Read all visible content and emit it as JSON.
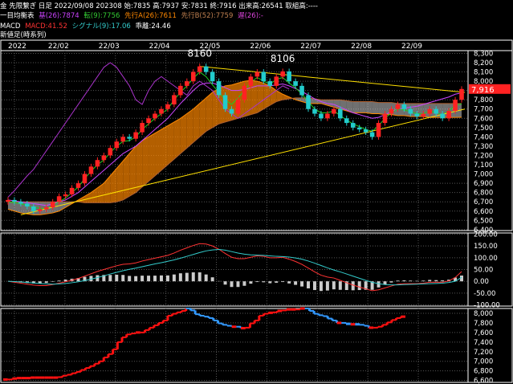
{
  "header": {
    "line1": "金 先限繋ぎ 日足 2022/09/08 202308 始:7835 高:7937 安:7831 終:7916 出来高:26541 取組高:----",
    "ichimoku": {
      "name": "一目均衡表",
      "items": [
        {
          "text": "基(26):7874",
          "color": "#cc44ff"
        },
        {
          "text": "転(9):7756",
          "color": "#33cc33"
        },
        {
          "text": "先行A(26):7611",
          "color": "#ff8800"
        },
        {
          "text": "先行B(52):7759",
          "color": "#c08050"
        },
        {
          "text": "遅(26):-",
          "color": "#dd44dd"
        }
      ]
    },
    "macd": {
      "name": "MACD",
      "items": [
        {
          "text": "MACD:41.52",
          "color": "#ff3333"
        },
        {
          "text": "シグナル(9):17.06",
          "color": "#33cccc"
        },
        {
          "text": "乖離:24.46",
          "color": "#ffffff"
        }
      ]
    },
    "line4": "新値足(時系列)"
  },
  "colors": {
    "up": "#ff2222",
    "down": "#22cccc",
    "tenkan": "#22cc22",
    "kijun": "#cc44ff",
    "chikou": "#aa33cc",
    "kumoUp": "#ff8800",
    "kumoDown": "#cccccc",
    "trend": "#ffe000",
    "macd": "#ff3333",
    "signal": "#33cccc",
    "hist": "#cccccc",
    "pos": "#ff1111",
    "neg": "#3399ff",
    "grid": "#555555",
    "last": "#ff2222"
  },
  "chart_data": [
    {
      "type": "candlestick",
      "x_labels": [
        "2022",
        "22/02",
        "22/03",
        "22/04",
        "22/05",
        "22/06",
        "22/07",
        "22/08",
        "22/09"
      ],
      "y_ticks": [
        6400,
        6500,
        6600,
        6700,
        6800,
        6900,
        7000,
        7100,
        7200,
        7300,
        7400,
        7500,
        7600,
        7700,
        7800,
        7900,
        8000,
        8100,
        8200,
        8300
      ],
      "ylim": [
        6390,
        8330
      ],
      "annotations": [
        {
          "text": "8160",
          "value": 8160
        },
        {
          "text": "8106",
          "value": 8106
        }
      ],
      "last_value": 7916,
      "last_label": "7,916",
      "series": [
        {
          "name": "close",
          "values": [
            6720,
            6700,
            6680,
            6650,
            6600,
            6620,
            6640,
            6700,
            6760,
            6780,
            6850,
            6900,
            7000,
            7080,
            7150,
            7200,
            7280,
            7350,
            7400,
            7380,
            7450,
            7550,
            7600,
            7650,
            7700,
            7750,
            7850,
            7950,
            8000,
            8100,
            8160,
            8100,
            8000,
            7850,
            7700,
            7650,
            7800,
            7950,
            8050,
            8100,
            8000,
            7950,
            8050,
            8106,
            8000,
            7950,
            7850,
            7700,
            7650,
            7600,
            7650,
            7700,
            7600,
            7550,
            7500,
            7480,
            7450,
            7400,
            7550,
            7650,
            7700,
            7750,
            7700,
            7650,
            7620,
            7650,
            7700,
            7650,
            7600,
            7680,
            7800,
            7916
          ]
        },
        {
          "name": "tenkan",
          "values": [
            6700,
            6690,
            6680,
            6660,
            6640,
            6630,
            6620,
            6660,
            6700,
            6740,
            6800,
            6860,
            6950,
            7030,
            7100,
            7150,
            7230,
            7300,
            7350,
            7360,
            7400,
            7480,
            7540,
            7600,
            7650,
            7700,
            7800,
            7880,
            7950,
            8030,
            8100,
            8050,
            7960,
            7880,
            7800,
            7750,
            7820,
            7900,
            7990,
            8040,
            8000,
            7970,
            8020,
            8040,
            7980,
            7930,
            7860,
            7780,
            7700,
            7660,
            7660,
            7680,
            7630,
            7580,
            7540,
            7510,
            7480,
            7460,
            7520,
            7600,
            7660,
            7700,
            7690,
            7670,
            7650,
            7650,
            7680,
            7660,
            7640,
            7680,
            7740,
            7756
          ]
        },
        {
          "name": "kijun",
          "values": [
            6720,
            6710,
            6700,
            6690,
            6680,
            6670,
            6660,
            6680,
            6700,
            6720,
            6760,
            6800,
            6860,
            6920,
            6980,
            7040,
            7100,
            7160,
            7220,
            7260,
            7300,
            7360,
            7420,
            7480,
            7540,
            7600,
            7680,
            7760,
            7830,
            7900,
            7960,
            7980,
            7980,
            7960,
            7930,
            7900,
            7900,
            7910,
            7930,
            7950,
            7950,
            7950,
            7960,
            7970,
            7950,
            7920,
            7890,
            7850,
            7810,
            7780,
            7760,
            7750,
            7720,
            7690,
            7660,
            7640,
            7620,
            7600,
            7610,
            7640,
            7670,
            7700,
            7710,
            7720,
            7730,
            7750,
            7770,
            7790,
            7810,
            7830,
            7860,
            7874
          ]
        },
        {
          "name": "senkouA",
          "values": [
            6620,
            6600,
            6580,
            6570,
            6560,
            6560,
            6570,
            6580,
            6600,
            6640,
            6680,
            6720,
            6760,
            6800,
            6850,
            6900,
            6980,
            7060,
            7140,
            7220,
            7300,
            7360,
            7400,
            7440,
            7480,
            7520,
            7560,
            7600,
            7650,
            7700,
            7760,
            7820,
            7880,
            7920,
            7950,
            7960,
            7980,
            8000,
            8010,
            8000,
            7980,
            7950,
            7900,
            7860,
            7830,
            7800,
            7780,
            7760,
            7760,
            7760,
            7740,
            7720,
            7700,
            7680,
            7660,
            7660,
            7660,
            7650,
            7650,
            7640,
            7640,
            7630,
            7630,
            7620,
            7620,
            7620,
            7610,
            7610,
            7610,
            7610,
            7610,
            7611
          ]
        },
        {
          "name": "senkouB",
          "values": [
            6700,
            6700,
            6700,
            6700,
            6700,
            6700,
            6700,
            6700,
            6700,
            6700,
            6700,
            6700,
            6690,
            6690,
            6690,
            6690,
            6690,
            6700,
            6720,
            6760,
            6800,
            6860,
            6920,
            6980,
            7040,
            7100,
            7160,
            7220,
            7280,
            7340,
            7400,
            7460,
            7500,
            7540,
            7560,
            7580,
            7600,
            7620,
            7640,
            7660,
            7700,
            7740,
            7780,
            7800,
            7810,
            7820,
            7820,
            7820,
            7810,
            7800,
            7800,
            7800,
            7800,
            7790,
            7780,
            7780,
            7780,
            7780,
            7770,
            7770,
            7770,
            7760,
            7760,
            7760,
            7760,
            7760,
            7760,
            7760,
            7760,
            7759,
            7759,
            7759
          ]
        },
        {
          "name": "chikou",
          "values": [
            6750,
            6820,
            6900,
            6980,
            7050,
            7150,
            7250,
            7350,
            7450,
            7550,
            7650,
            7750,
            7850,
            7950,
            8050,
            8150,
            8200,
            8150,
            8050,
            7950,
            7800,
            7750,
            7900,
            8000,
            8050,
            8000,
            7950,
            7900,
            7850,
            7950,
            8000,
            7950,
            7900,
            7800,
            7700,
            7650,
            7600,
            7650,
            7700,
            7750,
            7800,
            7850,
            7900,
            7950,
            7916
          ]
        }
      ]
    },
    {
      "type": "line",
      "y_ticks": [
        -100,
        -50,
        0,
        50,
        100,
        150,
        200
      ],
      "y_labels": [
        "-100.00",
        "-50.00",
        "0.00",
        "50.00",
        "100.00",
        "150.00",
        "200.00"
      ],
      "ylim": [
        -105,
        205
      ],
      "series": [
        {
          "name": "MACD",
          "values": [
            0,
            -4,
            -8,
            -12,
            -16,
            -18,
            -18,
            -14,
            -8,
            -2,
            5,
            12,
            22,
            32,
            42,
            50,
            58,
            66,
            72,
            74,
            78,
            86,
            92,
            98,
            104,
            110,
            120,
            132,
            142,
            152,
            160,
            158,
            150,
            136,
            118,
            102,
            96,
            96,
            102,
            108,
            106,
            100,
            100,
            102,
            94,
            84,
            72,
            56,
            40,
            26,
            18,
            14,
            4,
            -6,
            -16,
            -24,
            -32,
            -40,
            -36,
            -28,
            -20,
            -12,
            -10,
            -10,
            -10,
            -8,
            -4,
            -4,
            -4,
            2,
            16,
            41.52
          ]
        },
        {
          "name": "Signal",
          "values": [
            0,
            -1,
            -3,
            -5,
            -7,
            -9,
            -11,
            -12,
            -11,
            -9,
            -6,
            -2,
            3,
            9,
            16,
            23,
            31,
            38,
            45,
            51,
            56,
            62,
            68,
            74,
            79,
            85,
            91,
            98,
            106,
            114,
            122,
            129,
            133,
            135,
            132,
            126,
            120,
            115,
            112,
            111,
            110,
            108,
            106,
            105,
            103,
            99,
            94,
            86,
            77,
            67,
            57,
            48,
            40,
            31,
            22,
            13,
            4,
            -4,
            -10,
            -14,
            -15,
            -15,
            -14,
            -13,
            -12,
            -11,
            -10,
            -9,
            -8,
            -5,
            0,
            17.06
          ]
        }
      ]
    },
    {
      "type": "step",
      "y_ticks": [
        6600,
        6800,
        7000,
        7200,
        7400,
        7600,
        7800,
        8000
      ],
      "ylim": [
        6560,
        8100
      ],
      "values": [
        6620,
        6620,
        6640,
        6650,
        6650,
        6650,
        6660,
        6660,
        6660,
        6660,
        6660,
        6660,
        6670,
        6700,
        6720,
        6750,
        6780,
        6820,
        6860,
        6900,
        6950,
        7000,
        7080,
        7150,
        7250,
        7400,
        7500,
        7560,
        7580,
        7600,
        7600,
        7650,
        7700,
        7750,
        7800,
        7850,
        7950,
        7990,
        8020,
        8050,
        8100,
        8060,
        7980,
        7950,
        7930,
        7900,
        7850,
        7790,
        7760,
        7740,
        7720,
        7720,
        7690,
        7700,
        7790,
        7850,
        7950,
        7990,
        8010,
        8020,
        8050,
        8060,
        8080,
        8080,
        8080,
        8100,
        8100,
        8050,
        7990,
        7960,
        7940,
        7890,
        7850,
        7800,
        7800,
        7780,
        7770,
        7770,
        7760,
        7740,
        7700,
        7700,
        7720,
        7760,
        7810,
        7860,
        7900,
        7930,
        7930
      ]
    }
  ]
}
